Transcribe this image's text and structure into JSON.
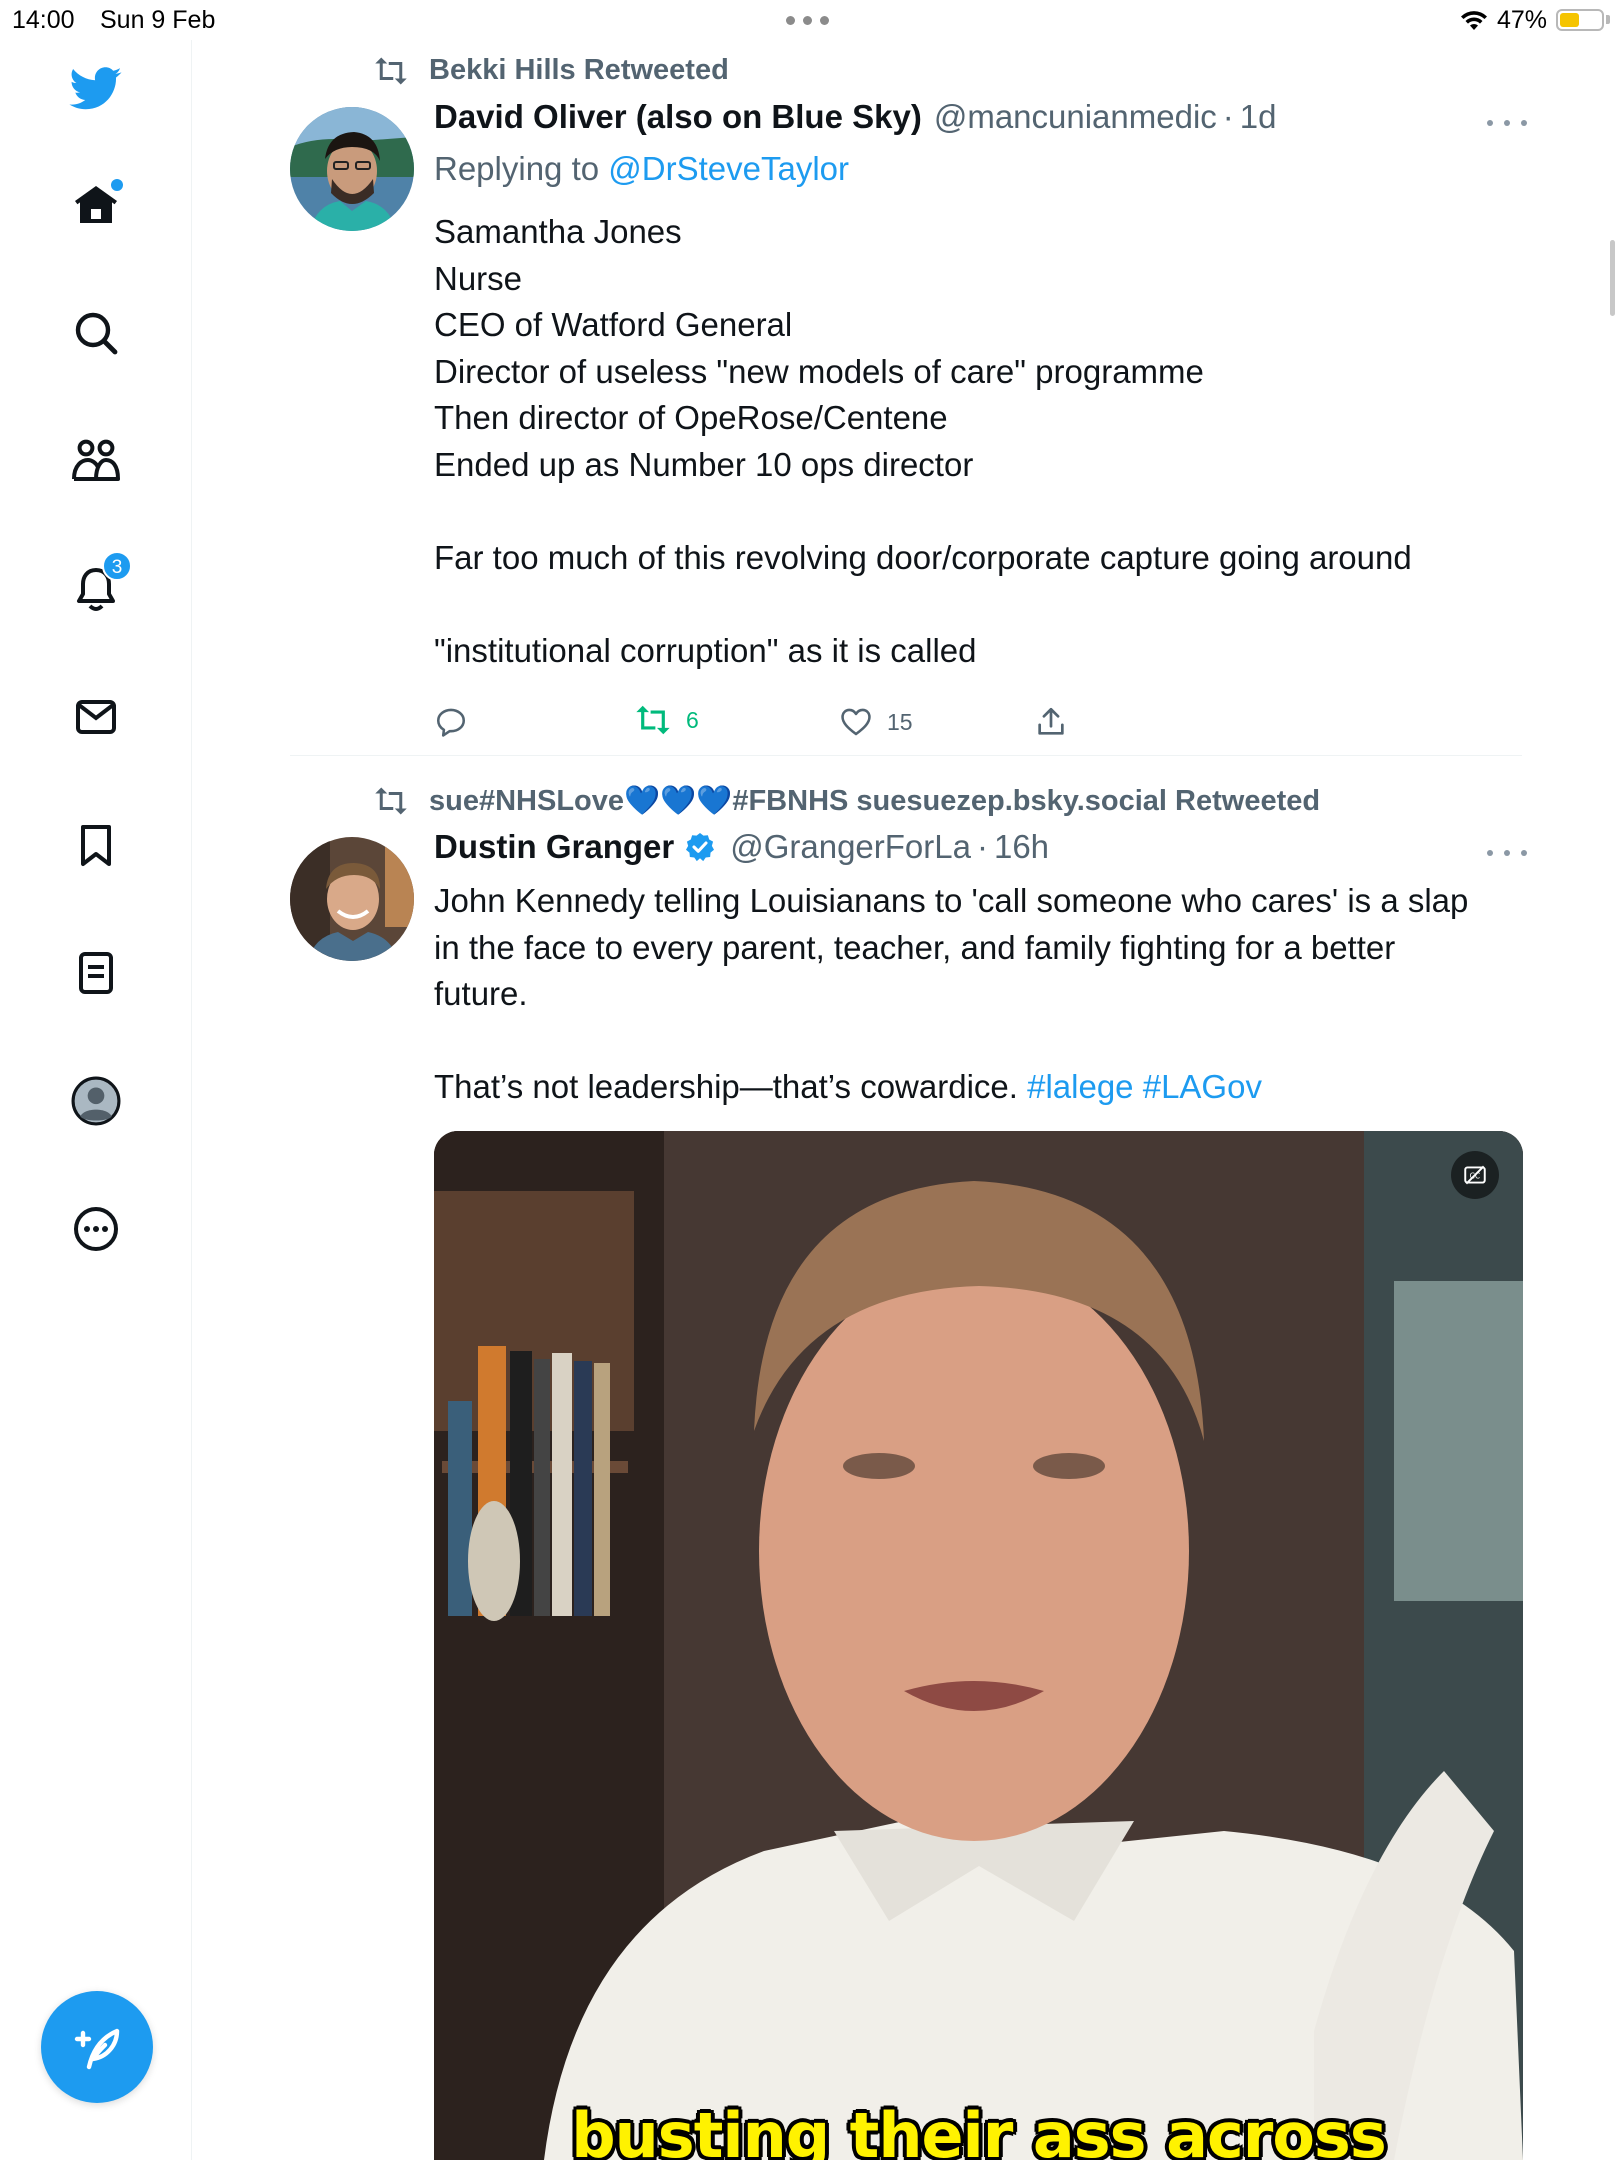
{
  "status_bar": {
    "time": "14:00",
    "date": "Sun 9 Feb",
    "battery": "47%",
    "battery_level": 0.47
  },
  "sidebar": {
    "notifications_badge": "3",
    "icons": [
      "twitter-logo-icon",
      "home-icon",
      "search-icon",
      "communities-icon",
      "notifications-icon",
      "messages-icon",
      "bookmarks-icon",
      "lists-icon",
      "profile-icon",
      "more-icon",
      "compose-icon"
    ]
  },
  "tweets": [
    {
      "retweeted_by": "Bekki Hills Retweeted",
      "name": "David Oliver (also on Blue Sky)",
      "handle": "@mancunianmedic",
      "dot": "·",
      "time": "1d",
      "replying_prefix": "Replying to",
      "replying_to": "@DrSteveTaylor",
      "lines": [
        "Samantha Jones",
        "Nurse",
        "CEO of Watford General",
        "Director of useless \"new models of care\" programme",
        "Then director of OpeRose/Centene",
        "Ended up as Number 10 ops director",
        "",
        "Far too much of this revolving door/corporate capture going around",
        "",
        "\"institutional corruption\" as it is called"
      ],
      "retweets": "6",
      "likes": "15"
    },
    {
      "retweeted_by": "sue#NHSLove💙💙💙#FBNHS suesuezep.bsky.social Retweeted",
      "name": "Dustin Granger",
      "handle": "@GrangerForLa",
      "dot": "·",
      "time": "16h",
      "lines": [
        "John Kennedy telling Louisianans to 'call someone who cares' is a slap",
        "in the face to every parent, teacher, and family fighting for a better",
        "future.",
        ""
      ],
      "last_line_text": "That’s not leadership—that’s cowardice. ",
      "hashtag1": "#lalege",
      "hashtag2": "#LAGov",
      "video_caption": "busting their ass across"
    }
  ],
  "colors": {
    "accent": "#1d9bf0",
    "retweet_green": "#00ba7c",
    "secondary_text": "#536471",
    "caption_yellow": "#fff200"
  }
}
